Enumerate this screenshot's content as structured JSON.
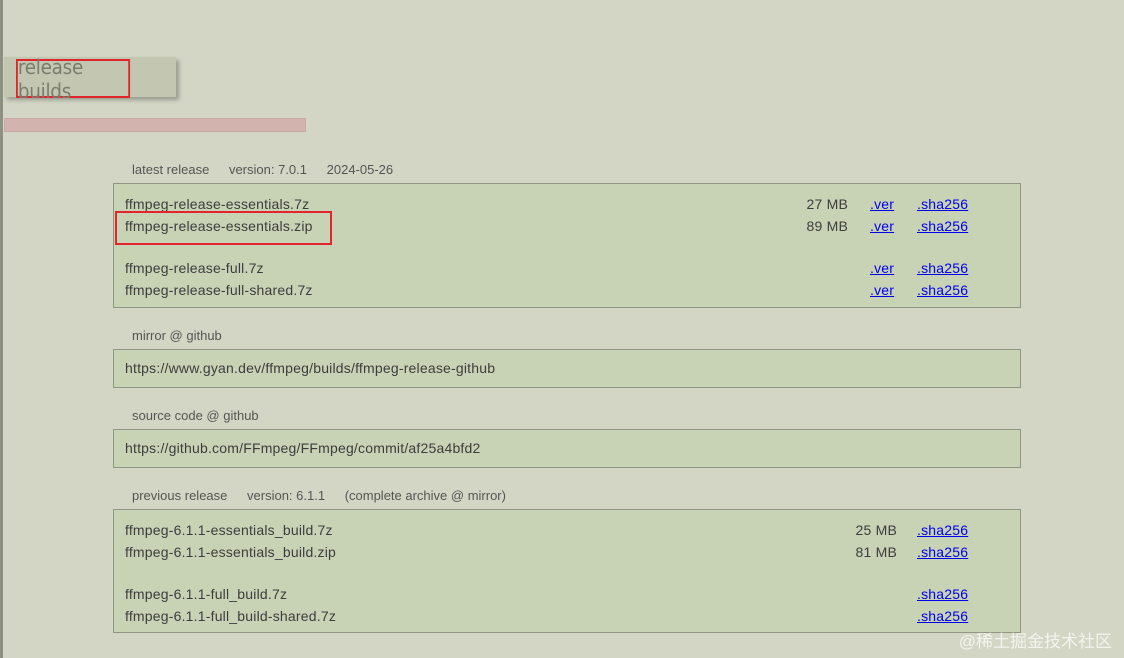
{
  "section": {
    "title": "release builds"
  },
  "latest": {
    "label": "latest release",
    "version": "version: 7.0.1",
    "date": "2024-05-26",
    "files": [
      {
        "name": "ffmpeg-release-essentials.7z",
        "size": "27 MB",
        "ver": ".ver",
        "sha": ".sha256"
      },
      {
        "name": "ffmpeg-release-essentials.zip",
        "size": "89 MB",
        "ver": ".ver",
        "sha": ".sha256"
      },
      {
        "name": "ffmpeg-release-full.7z",
        "size": "",
        "ver": ".ver",
        "sha": ".sha256"
      },
      {
        "name": "ffmpeg-release-full-shared.7z",
        "size": "",
        "ver": ".ver",
        "sha": ".sha256"
      }
    ]
  },
  "mirror": {
    "label": "mirror @ github",
    "url": "https://www.gyan.dev/ffmpeg/builds/ffmpeg-release-github"
  },
  "source": {
    "label": "source code @ github",
    "url": "https://github.com/FFmpeg/FFmpeg/commit/af25a4bfd2"
  },
  "previous": {
    "label": "previous release",
    "version": "version: 6.1.1",
    "archive": "(complete archive @ mirror)",
    "files": [
      {
        "name": "ffmpeg-6.1.1-essentials_build.7z",
        "size": "25 MB",
        "sha": ".sha256"
      },
      {
        "name": "ffmpeg-6.1.1-essentials_build.zip",
        "size": "81 MB",
        "sha": ".sha256"
      },
      {
        "name": "ffmpeg-6.1.1-full_build.7z",
        "size": "",
        "sha": ".sha256"
      },
      {
        "name": "ffmpeg-6.1.1-full_build-shared.7z",
        "size": "",
        "sha": ".sha256"
      }
    ]
  },
  "watermark": "@稀土掘金技术社区",
  "colors": {
    "page_bg": "#d3d6c5",
    "panel_bg": "#c8d2b5",
    "highlight_red": "#e0262a",
    "accent_bar": "#d2b3ae"
  }
}
